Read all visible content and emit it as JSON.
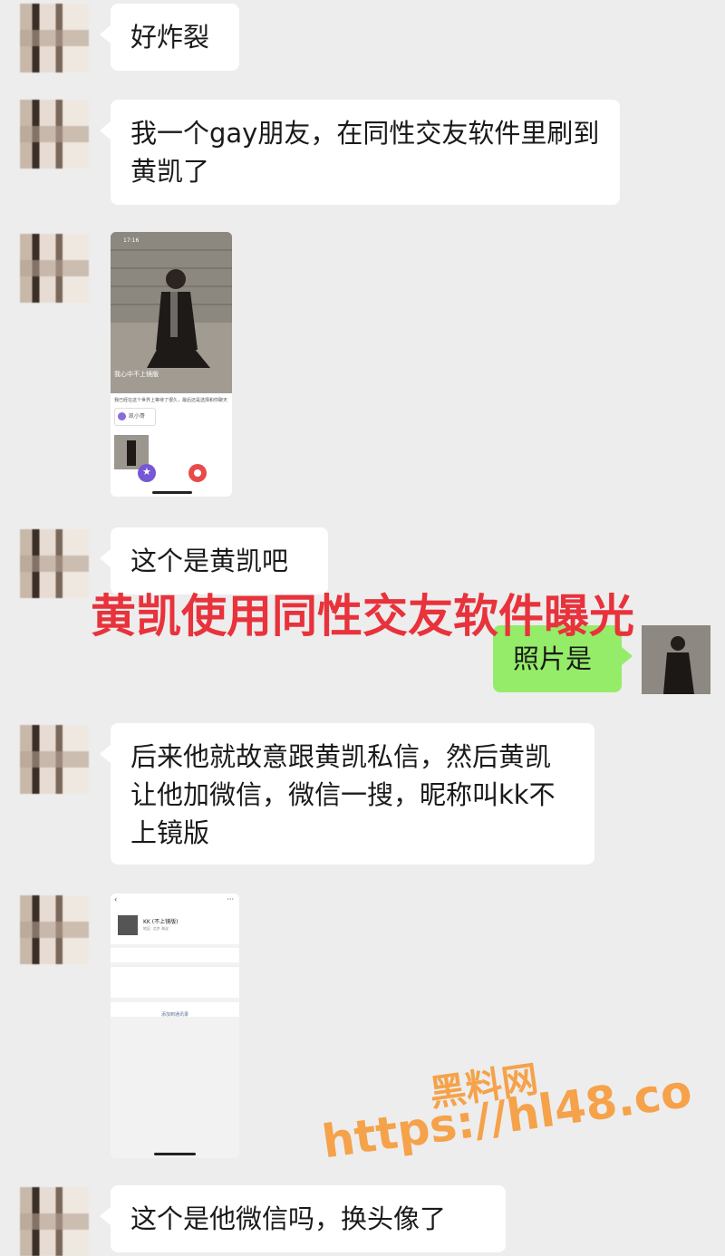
{
  "messages": [
    {
      "text": "好炸裂"
    },
    {
      "text": "我一个gay朋友，在同性交友软件里刷到黄凯了"
    },
    {
      "text": "这个是黄凯吧"
    },
    {
      "text": "后来他就故意跟黄凯私信，然后黄凯让他加微信，微信一搜，昵称叫kk不上镜版"
    },
    {
      "text": "这个是他微信吗，换头像了"
    }
  ],
  "reply": {
    "text": "照片是"
  },
  "overlay_title": "黄凯使用同性交友软件曝光",
  "watermark": {
    "line1": "黑料网",
    "line2": "https://hl48.co"
  },
  "screenshot1": {
    "status_time": "17:16",
    "photo_caption": "我心中不上镜版",
    "profile_line": "我已经在这个世界上等待了很久，最后还是选择和你聊天",
    "name": "凯小哥"
  },
  "screenshot2": {
    "nickname": "KK (不上镜版)",
    "region": "地区: 北京 海淀",
    "add_friend": "添加到通讯录"
  },
  "colors": {
    "background": "#ededed",
    "bubble": "#ffffff",
    "reply_bubble": "#95ec69",
    "overlay_red": "#e8323c",
    "watermark": "#f5a24a"
  }
}
